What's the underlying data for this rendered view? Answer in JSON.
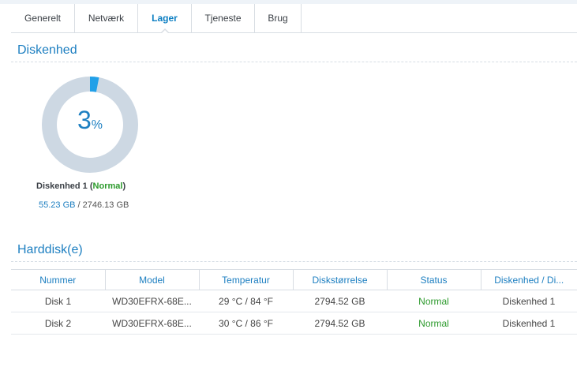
{
  "tabs": [
    {
      "label": "Generelt",
      "active": false
    },
    {
      "label": "Netværk",
      "active": false
    },
    {
      "label": "Lager",
      "active": true
    },
    {
      "label": "Tjeneste",
      "active": false
    },
    {
      "label": "Brug",
      "active": false
    }
  ],
  "volume_section": {
    "title": "Diskenhed",
    "usage_percent": 3,
    "usage_number": "3",
    "usage_unit": "%",
    "volume_name": "Diskenhed 1",
    "volume_status": "Normal",
    "used": "55.23 GB",
    "separator": " / ",
    "total": "2746.13 GB"
  },
  "disk_section": {
    "title": "Harddisk(e)",
    "columns": [
      "Nummer",
      "Model",
      "Temperatur",
      "Diskstørrelse",
      "Status",
      "Diskenhed / Di..."
    ],
    "rows": [
      {
        "number": "Disk 1",
        "model": "WD30EFRX-68E...",
        "temperature": "29 °C / 84 °F",
        "size": "2794.52 GB",
        "status": "Normal",
        "volume": "Diskenhed 1"
      },
      {
        "number": "Disk 2",
        "model": "WD30EFRX-68E...",
        "temperature": "30 °C / 86 °F",
        "size": "2794.52 GB",
        "status": "Normal",
        "volume": "Diskenhed 1"
      }
    ]
  },
  "colors": {
    "accent": "#1d7fc1",
    "ok": "#2c9a2c",
    "gauge_track": "#cdd8e3",
    "gauge_fill": "#22a0e8"
  }
}
